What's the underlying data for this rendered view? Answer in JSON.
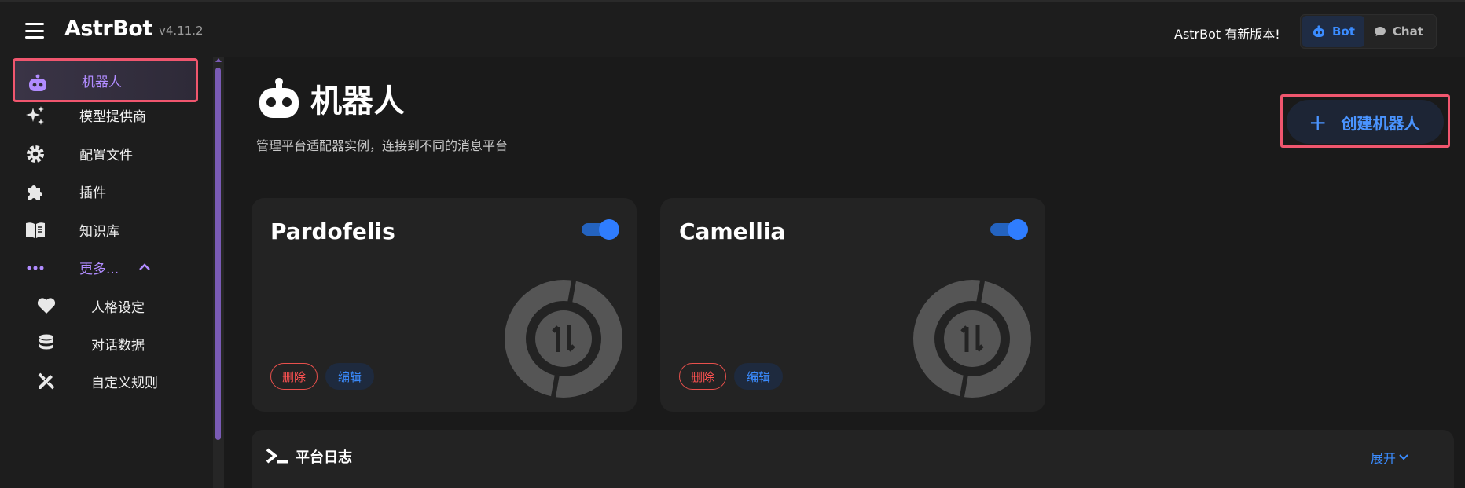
{
  "header": {
    "brand": "AstrBot",
    "version": "v4.11.2",
    "update_note": "AstrBot 有新版本!",
    "modes": [
      {
        "label": "Bot",
        "active": true
      },
      {
        "label": "Chat",
        "active": false
      }
    ]
  },
  "sidebar": {
    "items": [
      {
        "label": "机器人",
        "icon": "robot-icon",
        "active": true
      },
      {
        "label": "模型提供商",
        "icon": "sparkle-icon"
      },
      {
        "label": "配置文件",
        "icon": "gear-icon"
      },
      {
        "label": "插件",
        "icon": "puzzle-icon"
      },
      {
        "label": "知识库",
        "icon": "book-icon"
      },
      {
        "label": "更多...",
        "icon": "dots-icon"
      }
    ],
    "sub_items": [
      {
        "label": "人格设定",
        "icon": "heart-icon"
      },
      {
        "label": "对话数据",
        "icon": "database-icon"
      },
      {
        "label": "自定义规则",
        "icon": "ruler-pencil-icon"
      }
    ]
  },
  "main": {
    "title": "机器人",
    "subtitle": "管理平台适配器实例，连接到不同的消息平台",
    "create_button": "创建机器人",
    "cards": [
      {
        "name": "Pardofelis",
        "enabled": true,
        "delete_label": "删除",
        "edit_label": "编辑"
      },
      {
        "name": "Camellia",
        "enabled": true,
        "delete_label": "删除",
        "edit_label": "编辑"
      }
    ],
    "log": {
      "title": "平台日志",
      "expand_label": "展开"
    }
  },
  "colors": {
    "accent_purple": "#b18cff",
    "accent_blue": "#3b8cff",
    "highlight_red": "#f0566e",
    "delete_red": "#ff5252"
  }
}
